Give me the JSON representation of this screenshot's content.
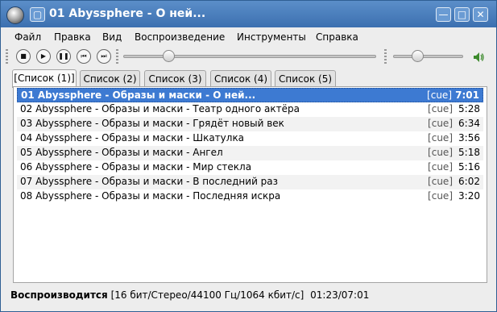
{
  "window": {
    "title": "01 Abyssphere - О ней...",
    "controls": {
      "minimize": "—",
      "maximize": "□",
      "close": "✕"
    }
  },
  "menu": [
    "Файл",
    "Правка",
    "Вид",
    "Воспроизведение",
    "Инструменты",
    "Справка"
  ],
  "toolbar": {
    "buttons": [
      "stop-icon",
      "play-icon",
      "pause-icon",
      "previous-icon",
      "next-icon"
    ],
    "seek_fraction": 0.18,
    "volume_fraction": 0.35,
    "volume_icon": "speaker-icon"
  },
  "tabs": [
    "[Список (1)]",
    "Список (2)",
    "Список (3)",
    "Список (4)",
    "Список (5)"
  ],
  "playlist": [
    {
      "title": "01 Abyssphere - Образы и маски - О ней...",
      "cue": "[cue]",
      "duration": "7:01",
      "current": true
    },
    {
      "title": "02 Abyssphere - Образы и маски - Театр одного актёра",
      "cue": "[cue]",
      "duration": "5:28"
    },
    {
      "title": "03 Abyssphere - Образы и маски - Грядёт новый век",
      "cue": "[cue]",
      "duration": "6:34"
    },
    {
      "title": "04 Abyssphere - Образы и маски - Шкатулка",
      "cue": "[cue]",
      "duration": "3:56"
    },
    {
      "title": "05 Abyssphere - Образы и маски - Ангел",
      "cue": "[cue]",
      "duration": "5:18"
    },
    {
      "title": "06 Abyssphere - Образы и маски - Мир стекла",
      "cue": "[cue]",
      "duration": "5:16"
    },
    {
      "title": "07 Abyssphere - Образы и маски - В последний раз",
      "cue": "[cue]",
      "duration": "6:02"
    },
    {
      "title": "08 Abyssphere - Образы и маски - Последняя искра",
      "cue": "[cue]",
      "duration": "3:20"
    }
  ],
  "status": {
    "label": "Воспроизводится",
    "info": "[16 бит/Стерео/44100 Гц/1064 кбит/с]",
    "time": "01:23/07:01"
  },
  "colors": {
    "titlebar": "#4a80c0",
    "selection": "#3d7ad2"
  }
}
